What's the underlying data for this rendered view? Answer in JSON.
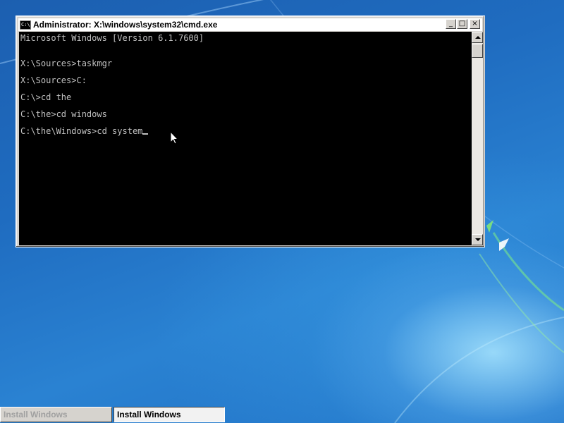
{
  "window": {
    "title": "Administrator: X:\\windows\\system32\\cmd.exe",
    "icon_text": "C:\\",
    "buttons": {
      "minimize": "_",
      "maximize": "□",
      "close": "×"
    }
  },
  "console": {
    "lines": [
      "Microsoft Windows [Version 6.1.7600]",
      "",
      "X:\\Sources>taskmgr",
      "",
      "X:\\Sources>C:",
      "",
      "C:\\>cd the",
      "",
      "C:\\the>cd windows",
      "",
      "C:\\the\\Windows>cd system"
    ]
  },
  "taskbar": {
    "items": [
      {
        "label": "Install Windows",
        "state": "inactive"
      },
      {
        "label": "Install Windows",
        "state": "active"
      }
    ]
  },
  "icons": {
    "window_icon": "cmd-window-icon",
    "cursor": "mouse-pointer-icon",
    "scroll_up": "scroll-up-arrow-icon",
    "scroll_down": "scroll-down-arrow-icon"
  },
  "colors": {
    "desktop": "#1f6cc0",
    "console_bg": "#000000",
    "console_text": "#c0c0c0",
    "window_frame": "#d6d3ce"
  }
}
